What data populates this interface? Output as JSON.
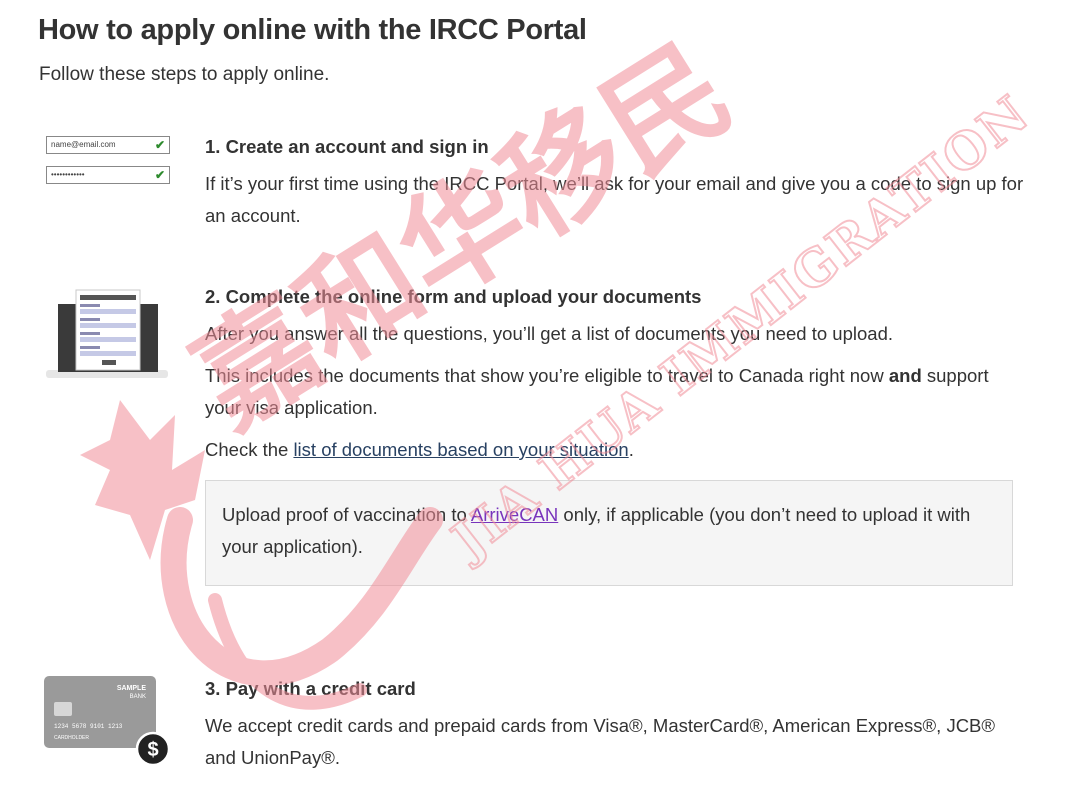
{
  "page": {
    "title": "How to apply online with the IRCC Portal",
    "subtitle": "Follow these steps to apply online."
  },
  "step1": {
    "heading": "1. Create an account and sign in",
    "body": "If it’s your first time using the IRCC Portal, we’ll ask for your email and give you a code to sign up for an account.",
    "icon": {
      "name": "login-form-icon",
      "email_text": "name@email.com",
      "password_text": "••••••••••••"
    }
  },
  "step2": {
    "heading": "2. Complete the online form and upload your documents",
    "para1": "After you answer all the questions, you’ll get a list of documents you need to upload.",
    "para2_prefix": "This includes the documents that show you’re eligible to travel to Canada right now ",
    "para2_bold": "and",
    "para2_suffix": " support your visa application.",
    "para3_prefix": "Check the ",
    "para3_link": "list of documents based on your situation",
    "para3_suffix": ".",
    "callout_prefix": "Upload proof of vaccination to ",
    "callout_link": "ArriveCAN",
    "callout_suffix": " only, if applicable (you don’t need to upload it with your application).",
    "icon": {
      "name": "laptop-form-icon"
    }
  },
  "step3": {
    "heading": "3. Pay with a credit card",
    "body": "We accept credit cards and prepaid cards from Visa®, MasterCard®, American Express®, JCB® and UnionPay®.",
    "icon": {
      "name": "credit-card-icon",
      "bank_line1": "SAMPLE",
      "bank_line2": "BANK",
      "card_number": "1234  5678  9101  1213",
      "card_holder": "CARDHOLDER",
      "badge_symbol": "$"
    }
  },
  "watermark": {
    "chinese": "嘉和华移民",
    "english": "JIA HUA IMMIGRATION",
    "color": "#f08c98"
  },
  "colors": {
    "text": "#333333",
    "link": "#284162",
    "visited_link": "#7834bc",
    "callout_bg": "#f5f5f5"
  }
}
